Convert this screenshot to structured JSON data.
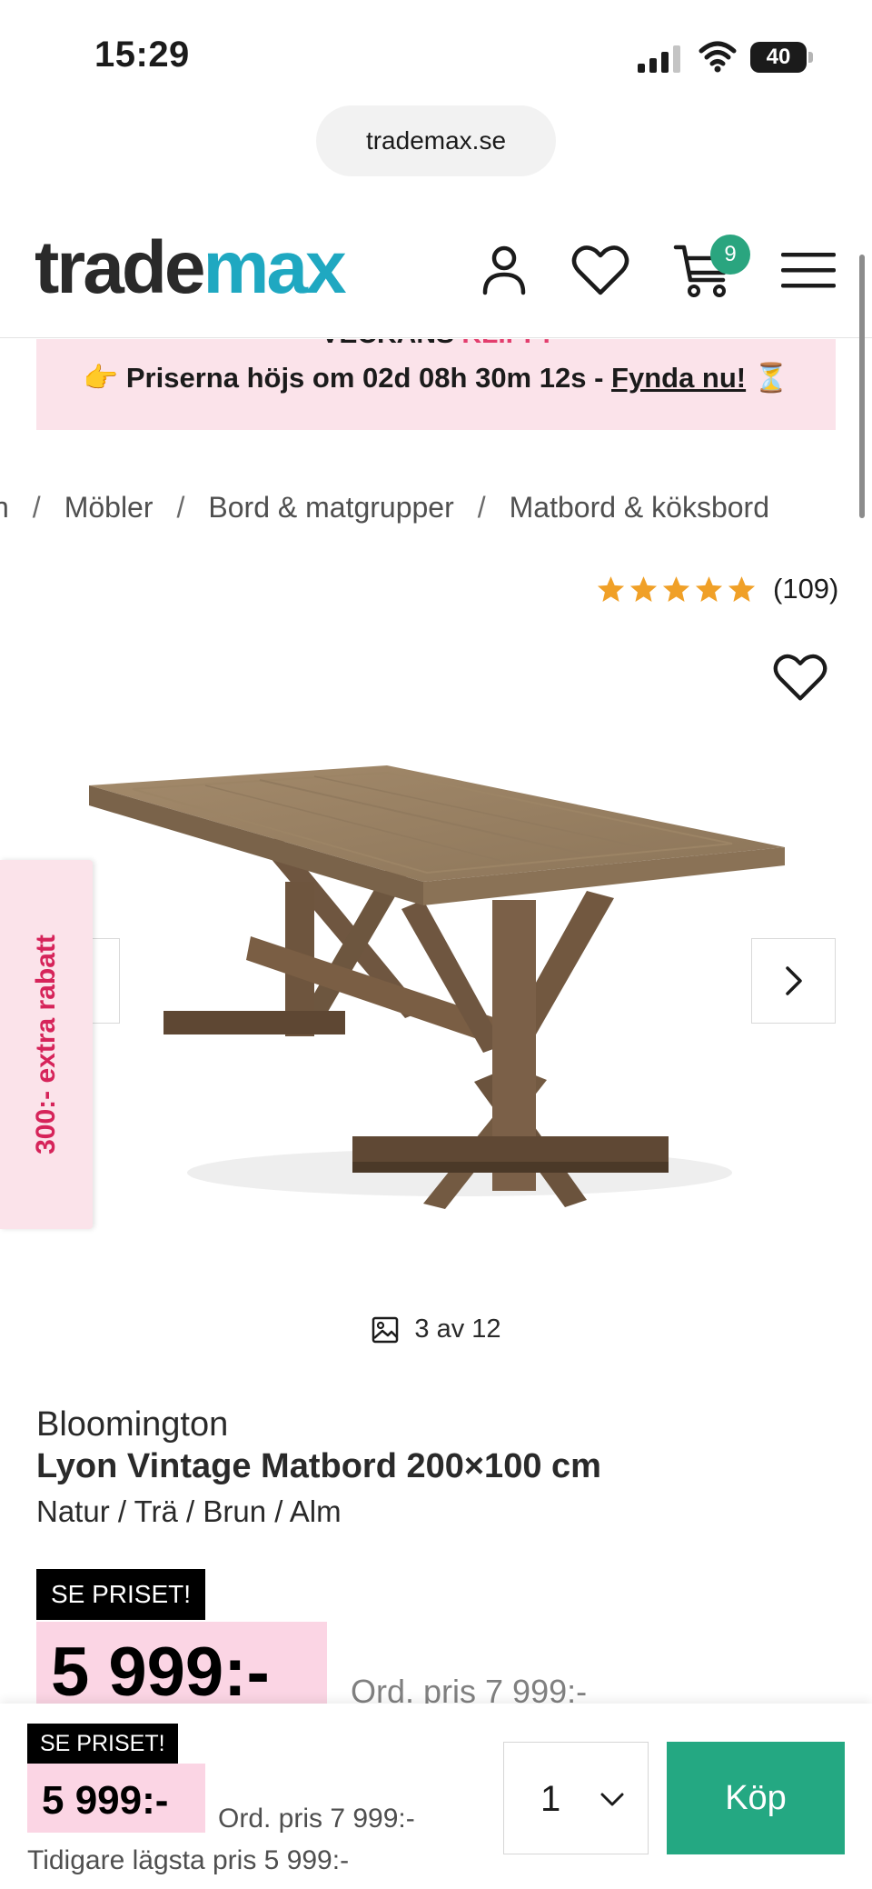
{
  "status_bar": {
    "time": "15:29",
    "battery": "40"
  },
  "browser": {
    "url": "trademax.se"
  },
  "header": {
    "logo_part1": "trade",
    "logo_part2": "max",
    "cart_count": "9"
  },
  "promo": {
    "top_text_a": "VECKANS ",
    "top_text_b": "KLIPP!",
    "emoji_left": "👉",
    "text": " Priserna höjs om 02d 08h 30m 12s - ",
    "cta": "Fynda nu!",
    "emoji_right": " ⏳"
  },
  "breadcrumb": {
    "items": [
      "n",
      "Möbler",
      "Bord & matgrupper",
      "Matbord & köksbord"
    ],
    "separator": "/"
  },
  "rating": {
    "stars": 5,
    "count": "(109)"
  },
  "gallery": {
    "side_tab": "300:- extra rabatt",
    "counter": "3 av 12",
    "current": 3,
    "total": 12
  },
  "product": {
    "brand": "Bloomington",
    "title": "Lyon Vintage Matbord 200×100 cm",
    "variant": "Natur / Trä / Brun / Alm",
    "badge": "SE PRISET!",
    "price": "5 999:-",
    "ord_price": "Ord. pris 7 999:-"
  },
  "buy_bar": {
    "badge": "SE PRISET!",
    "price": "5 999:-",
    "ord_price": "Ord. pris 7 999:-",
    "prev_lowest": "Tidigare lägsta pris 5 999:-",
    "quantity": "1",
    "buy_label": "Köp"
  },
  "colors": {
    "logo_dark": "#2a2a2a",
    "logo_accent": "#1fa8c1",
    "promo_bg": "#fbe3ea",
    "promo_accent": "#e33d6d",
    "price_bg": "#fbd5e4",
    "buy_button": "#24a882",
    "star": "#f0a027"
  },
  "icons": [
    "signal-icon",
    "wifi-icon",
    "account-icon",
    "heart-icon",
    "cart-icon",
    "menu-icon",
    "star-icon",
    "chevron-right-icon",
    "chevron-down-icon",
    "image-icon"
  ]
}
